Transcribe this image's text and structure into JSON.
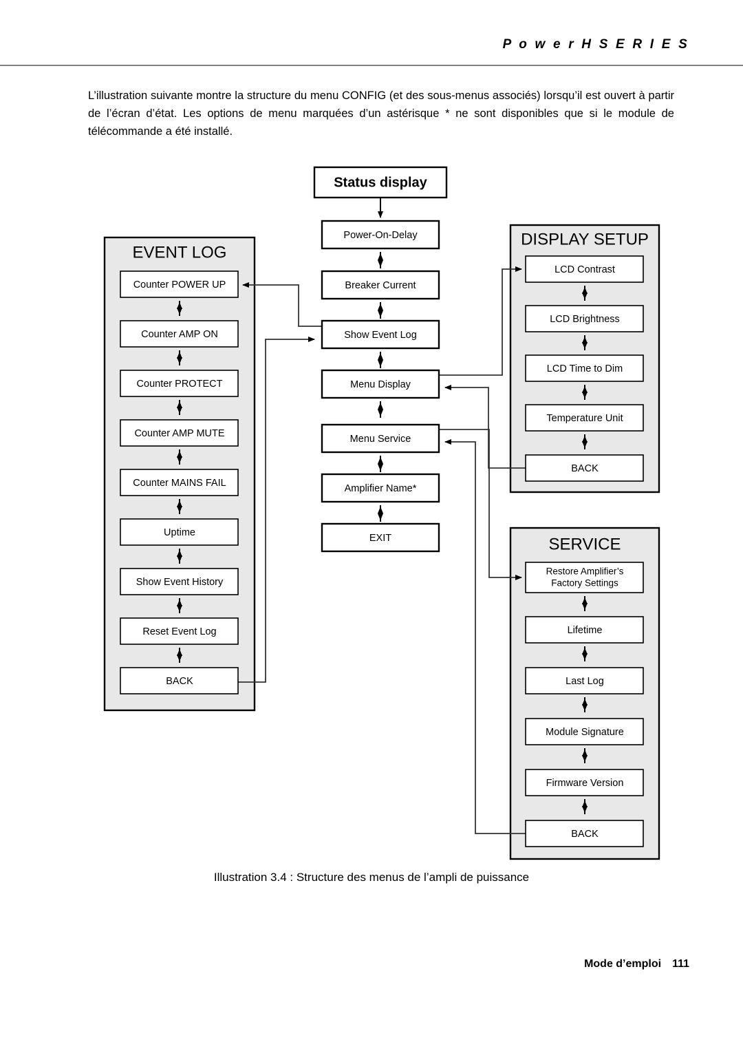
{
  "header": {
    "title": "P o w e r H   S E R I E S"
  },
  "intro": {
    "paragraph": "L’illustration suivante montre la structure du menu CONFIG (et des sous-menus associés) lorsqu’il est ouvert à partir de l’écran d’état. Les options de menu marquées d’un astérisque * ne sont disponibles que si le module de télécommande a été installé."
  },
  "diagram": {
    "colors": {
      "panel_fill": "#e8e8e8",
      "node_fill": "#ffffff",
      "stroke": "#000000"
    },
    "status_node": {
      "label": "Status display"
    },
    "main_column": {
      "nodes": [
        {
          "label": "Power-On-Delay"
        },
        {
          "label": "Breaker Current"
        },
        {
          "label": "Show Event Log"
        },
        {
          "label": "Menu Display"
        },
        {
          "label": "Menu Service"
        },
        {
          "label": "Amplifier Name*"
        },
        {
          "label": "EXIT"
        }
      ]
    },
    "event_log_panel": {
      "title": "EVENT LOG",
      "nodes": [
        {
          "label": "Counter POWER UP"
        },
        {
          "label": "Counter AMP ON"
        },
        {
          "label": "Counter PROTECT"
        },
        {
          "label": "Counter AMP MUTE"
        },
        {
          "label": "Counter MAINS FAIL"
        },
        {
          "label": "Uptime"
        },
        {
          "label": "Show Event History"
        },
        {
          "label": "Reset Event Log"
        },
        {
          "label": "BACK"
        }
      ]
    },
    "display_setup_panel": {
      "title": "DISPLAY SETUP",
      "nodes": [
        {
          "label": "LCD Contrast"
        },
        {
          "label": "LCD Brightness"
        },
        {
          "label": "LCD Time to Dim"
        },
        {
          "label": "Temperature Unit"
        },
        {
          "label": "BACK"
        }
      ]
    },
    "service_panel": {
      "title": "SERVICE",
      "nodes": [
        {
          "label": "Restore Amplifier’s",
          "label2": "Factory Settings"
        },
        {
          "label": "Lifetime"
        },
        {
          "label": "Last Log"
        },
        {
          "label": "Module Signature"
        },
        {
          "label": "Firmware Version"
        },
        {
          "label": "BACK"
        }
      ]
    }
  },
  "caption": {
    "text": "Illustration 3.4 : Structure des menus de l’ampli de puissance"
  },
  "footer": {
    "label": "Mode d’emploi",
    "page": "111"
  }
}
